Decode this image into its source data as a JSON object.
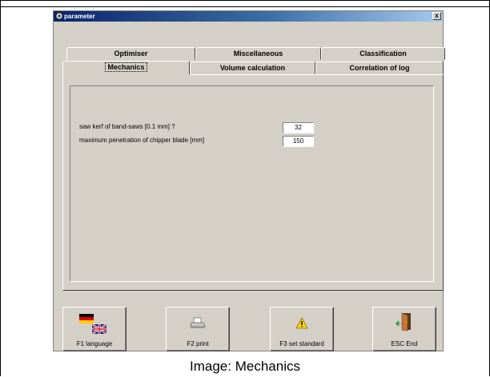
{
  "window": {
    "title": "parameter",
    "close_label": "x"
  },
  "tabs_back": [
    "Optimiser",
    "Miscellaneous",
    "Classification"
  ],
  "tabs_front": [
    "Mechanics",
    "Volume calculation",
    "Correlation of log"
  ],
  "active_tab": "Mechanics",
  "params": [
    {
      "label": "saw kerf of band-saws [0.1 mm] ?",
      "value": "32"
    },
    {
      "label": "maximum penetration of chipper blade [mm]",
      "value": "150"
    }
  ],
  "function_buttons": [
    {
      "label": "F1 language",
      "icon": "language-flags-icon"
    },
    {
      "label": "F2 print",
      "icon": "printer-icon"
    },
    {
      "label": "F3 set standard",
      "icon": "warning-icon"
    },
    {
      "label": "ESC End",
      "icon": "exit-door-icon"
    }
  ],
  "caption": "Image: Mechanics"
}
